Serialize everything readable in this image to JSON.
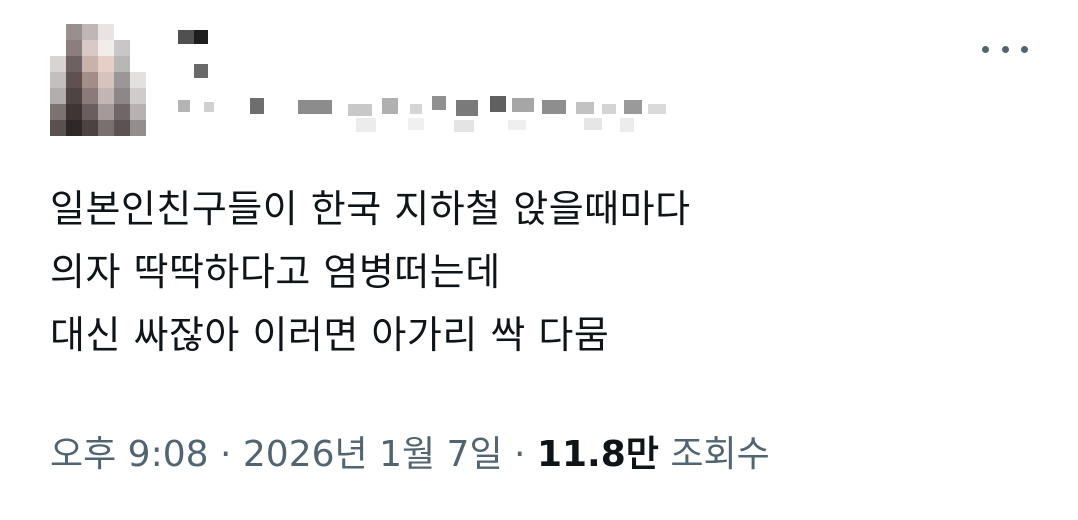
{
  "tweet": {
    "lines": [
      "일본인친구들이 한국 지하철 앉을때마다",
      "의자 딱딱하다고 염병떠는데",
      "대신 싸잖아 이러면 아가리 싹 다뭄"
    ],
    "time": "오후 9:08",
    "separator": "·",
    "date": "2026년 1월 7일",
    "views_count": "11.8만",
    "views_label": "조회수"
  },
  "icons": {
    "more": "more-horizontal-icon",
    "avatar": "pixelated-avatar"
  },
  "colors": {
    "text_primary": "#0f1419",
    "text_secondary": "#536471"
  }
}
